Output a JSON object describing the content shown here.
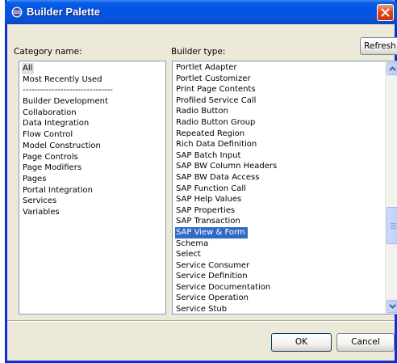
{
  "window": {
    "title": "Builder Palette"
  },
  "category": {
    "label": "Category name:",
    "items": [
      "All",
      "Most Recently Used",
      "-------------------------------",
      "Builder Development",
      "Collaboration",
      "Data Integration",
      "Flow Control",
      "Model Construction",
      "Page Controls",
      "Page Modifiers",
      "Pages",
      "Portal Integration",
      "Services",
      "Variables"
    ],
    "selected": "All"
  },
  "builder": {
    "label": "Builder type:",
    "items": [
      "Portlet Adapter",
      "Portlet Customizer",
      "Print Page Contents",
      "Profiled Service Call",
      "Radio Button",
      "Radio Button Group",
      "Repeated Region",
      "Rich Data Definition",
      "SAP Batch Input",
      "SAP BW Column Headers",
      "SAP BW Data Access",
      "SAP Function Call",
      "SAP Help Values",
      "SAP Properties",
      "SAP Transaction",
      "SAP View & Form",
      "Schema",
      "Select",
      "Service Consumer",
      "Service Definition",
      "Service Documentation",
      "Service Operation",
      "Service Stub"
    ],
    "selected": "SAP View & Form"
  },
  "buttons": {
    "refresh": "Refresh",
    "ok": "OK",
    "cancel": "Cancel"
  }
}
